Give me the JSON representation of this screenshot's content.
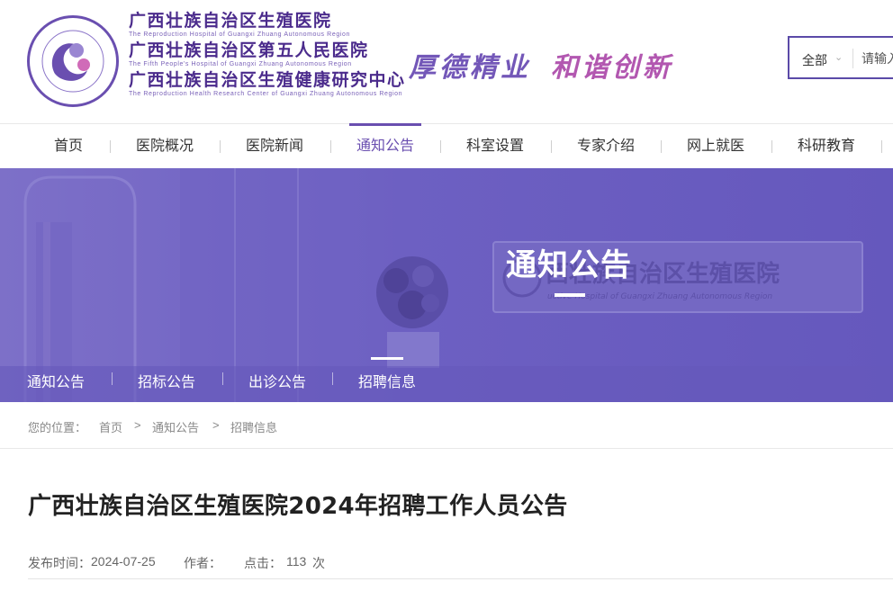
{
  "header": {
    "hospital_name_cn": "广西壮族自治区生殖医院",
    "hospital_name_en": "The Reproduction Hospital of Guangxi Zhuang Autonomous Region",
    "hospital_name2_cn": "广西壮族自治区第五人民医院",
    "hospital_name2_en": "The Fifth People's Hospital of Guangxi Zhuang Autonomous Region",
    "center_name_cn": "广西壮族自治区生殖健康研究中心",
    "center_name_en": "The Reproduction Health Research Center of Guangxi Zhuang Autonomous Region",
    "slogan_part1": "厚德精业",
    "slogan_part2": "和谐创新"
  },
  "search": {
    "scope": "全部",
    "placeholder": "请输入"
  },
  "nav": {
    "items": [
      {
        "label": "首页"
      },
      {
        "label": "医院概况"
      },
      {
        "label": "医院新闻"
      },
      {
        "label": "通知公告"
      },
      {
        "label": "科室设置"
      },
      {
        "label": "专家介绍"
      },
      {
        "label": "网上就医"
      },
      {
        "label": "科研教育"
      }
    ],
    "active": "通知公告"
  },
  "banner": {
    "title": "通知公告",
    "sub_nav": [
      {
        "label": "通知公告"
      },
      {
        "label": "招标公告"
      },
      {
        "label": "出诊公告"
      },
      {
        "label": "招聘信息"
      }
    ],
    "active_sub": "招聘信息",
    "sign_text_cn": "西壮族自治区生殖医院",
    "sign_text_en": "uctive Hospital of Guangxi Zhuang Autonomous Region"
  },
  "breadcrumb": {
    "prefix": "您的位置：",
    "items": [
      "首页",
      "通知公告",
      "招聘信息"
    ],
    "separator": ">"
  },
  "article": {
    "title": "广西壮族自治区生殖医院2024年招聘工作人员公告",
    "publish_label": "发布时间：",
    "publish_date": "2024-07-25",
    "author_label": "作者：",
    "author": "",
    "clicks_label": "点击：",
    "clicks": "113",
    "clicks_unit": "次"
  },
  "colors": {
    "brand_purple": "#6a4fb0",
    "banner_overlay": "#6b5cc0",
    "slogan_purple": "#7357b8",
    "slogan_magenta": "#b257b0"
  }
}
